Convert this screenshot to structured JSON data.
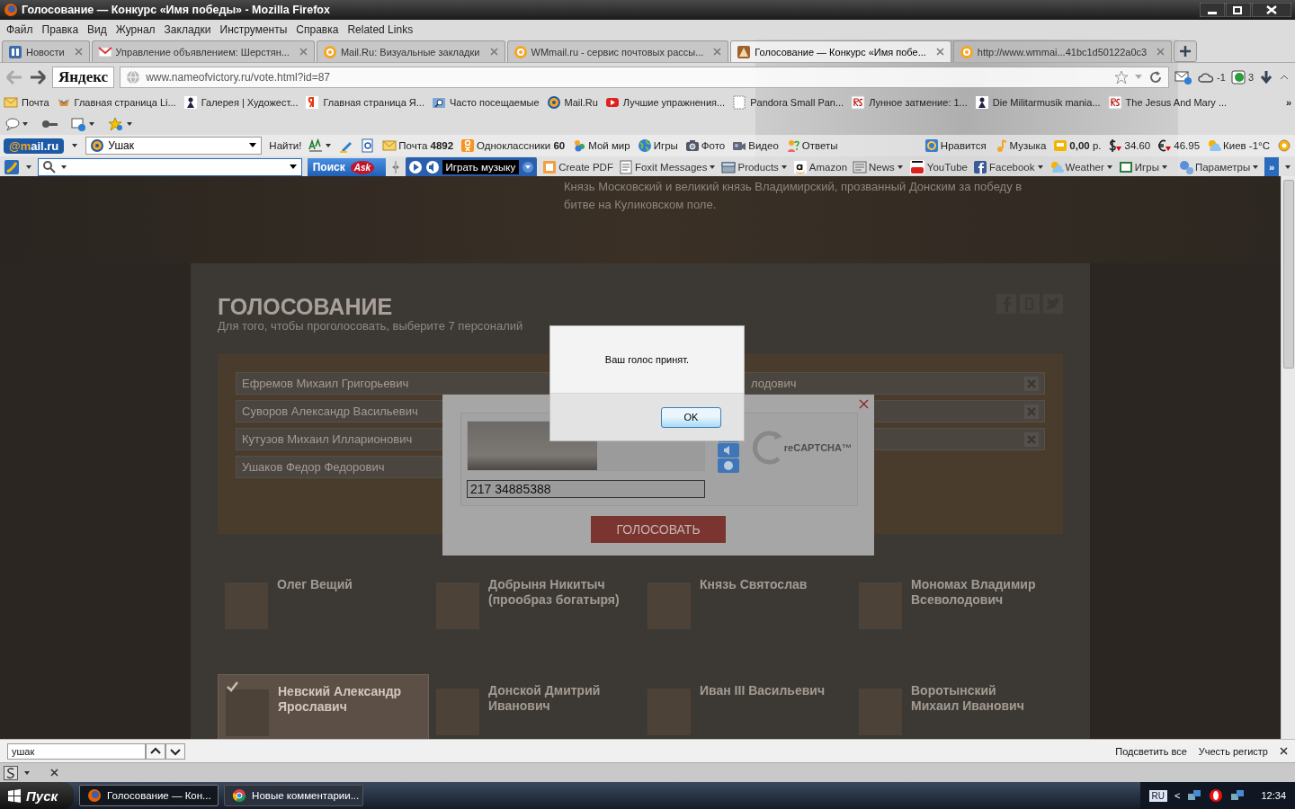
{
  "window": {
    "title": "Голосование — Конкурс «Имя победы» - Mozilla Firefox"
  },
  "menu": [
    "Файл",
    "Правка",
    "Вид",
    "Журнал",
    "Закладки",
    "Инструменты",
    "Справка",
    "Related Links"
  ],
  "tabs": [
    {
      "label": "Новости",
      "kind": "news",
      "selected": false
    },
    {
      "label": "Управление объявлением: Шерстян...",
      "kind": "gmail",
      "selected": false
    },
    {
      "label": "Mail.Ru: Визуальные закладки",
      "kind": "mailru",
      "selected": false
    },
    {
      "label": "WMmail.ru - сервис почтовых рассы...",
      "kind": "mailru",
      "selected": false
    },
    {
      "label": "Голосование — Конкурс «Имя побе...",
      "kind": "site",
      "selected": true
    },
    {
      "label": "http://www.wmmai...41bc1d50122a0c3",
      "kind": "mailru",
      "selected": false
    }
  ],
  "address": {
    "search_logo": "Яндекс",
    "url": "www.nameofvictory.ru/vote.html?id=87",
    "cloud_count": "-1",
    "badge_count": "3"
  },
  "bookmarks": [
    {
      "label": "Почта",
      "kind": "mail"
    },
    {
      "label": "Главная страница Li...",
      "kind": "bird"
    },
    {
      "label": "Галерея | Художест...",
      "kind": "gallery"
    },
    {
      "label": "Главная страница Я...",
      "kind": "yandex"
    },
    {
      "label": "Часто посещаемые",
      "kind": "folder"
    },
    {
      "label": "Mail.Ru",
      "kind": "mailru"
    },
    {
      "label": "Лучшие упражнения...",
      "kind": "youtube"
    },
    {
      "label": "Pandora Small Pan...",
      "kind": "page"
    },
    {
      "label": "Лунное затмение: 1...",
      "kind": "rs"
    },
    {
      "label": "Die Militarmusik mania...",
      "kind": "gallery"
    },
    {
      "label": "The Jesus And Mary ...",
      "kind": "rs"
    }
  ],
  "bookmarks_more": "»",
  "mailru_bar": {
    "logo": "@mail.ru",
    "search": "Ушак",
    "find": "Найти!",
    "items": [
      {
        "kind": "mail",
        "text": "Почта **4892**"
      },
      {
        "kind": "ok",
        "text": "Одноклассники **60**"
      },
      {
        "kind": "people",
        "text": "Мой мир"
      },
      {
        "kind": "globe",
        "text": "Игры"
      },
      {
        "kind": "camera",
        "text": "Фото"
      },
      {
        "kind": "video",
        "text": "Видео"
      },
      {
        "kind": "answers",
        "text": "Ответы"
      }
    ],
    "right_items": [
      {
        "kind": "at",
        "text": "Нравится"
      },
      {
        "kind": "note",
        "text": "Музыка"
      },
      {
        "kind": "wallet",
        "text": "**0,00** р."
      },
      {
        "kind": "dollar",
        "text": "34.60"
      },
      {
        "kind": "euro",
        "text": "46.95"
      },
      {
        "kind": "weather",
        "text": "Киев -1°C"
      }
    ]
  },
  "ask_bar": {
    "search_button": "Поиск",
    "logo": "Ask",
    "music": "Играть музыку",
    "items": [
      {
        "kind": "pdf",
        "text": "Create PDF",
        "menu": false
      },
      {
        "kind": "foxit",
        "text": "Foxit Messages",
        "menu": true
      },
      {
        "kind": "box",
        "text": "Products",
        "menu": true
      },
      {
        "kind": "amazon",
        "text": "Amazon",
        "menu": false
      },
      {
        "kind": "news",
        "text": "News",
        "menu": true
      },
      {
        "kind": "youtube",
        "text": "YouTube",
        "menu": false
      },
      {
        "kind": "facebook",
        "text": "Facebook",
        "menu": true
      },
      {
        "kind": "weather",
        "text": "Weather",
        "menu": true
      },
      {
        "kind": "cards",
        "text": "Игры",
        "menu": true
      }
    ],
    "settings": "Параметры",
    "more": "»"
  },
  "page": {
    "hero_text": "Князь Московский и великий князь Владимирский, прозванный Донским за победу в битве на Куликовском поле.",
    "heading": "ГОЛОСОВАНИЕ",
    "subtitle": "Для того, чтобы проголосовать, выберите 7 персоналий",
    "chosen_left": [
      "Ефремов Михаил Григорьевич",
      "Суворов Александр Васильевич",
      "Кутузов Михаил Илларионович",
      "Ушаков Федор Федорович"
    ],
    "chosen_right": [
      {
        "name": "лодович",
        "removable": true
      },
      {
        "removable": true
      },
      {
        "removable": true
      }
    ],
    "candidates": [
      {
        "name": "Олег Вещий",
        "selected": false
      },
      {
        "name": "Добрыня Никитыч (прообраз богатыря)",
        "selected": false
      },
      {
        "name": "Князь Святослав",
        "selected": false
      },
      {
        "name": "Мономах Владимир Всеволодович",
        "selected": false
      },
      {
        "name": "Невский Александр Ярославич",
        "selected": true
      },
      {
        "name": "Донской Дмитрий Иванович",
        "selected": false
      },
      {
        "name": "Иван III Васильевич",
        "selected": false
      },
      {
        "name": "Воротынский Михаил Иванович",
        "selected": false
      }
    ]
  },
  "captcha": {
    "answer": "217 34885388",
    "logo": "reCAPTCHA™",
    "submit": "ГОЛОСОВАТЬ"
  },
  "alert": {
    "message": "Ваш голос принят.",
    "button": "OK"
  },
  "find_bar": {
    "query": "ушак",
    "highlight_all": "Подсветить все",
    "match_case": "Учесть регистр"
  },
  "taskbar": {
    "start": "Пуск",
    "tasks": [
      {
        "label": "Голосование — Кон...",
        "kind": "firefox",
        "selected": true
      },
      {
        "label": "Новые комментарии...",
        "kind": "chrome",
        "selected": false
      }
    ],
    "language": "RU",
    "tray_toggle": "<",
    "clock": "12:34"
  }
}
